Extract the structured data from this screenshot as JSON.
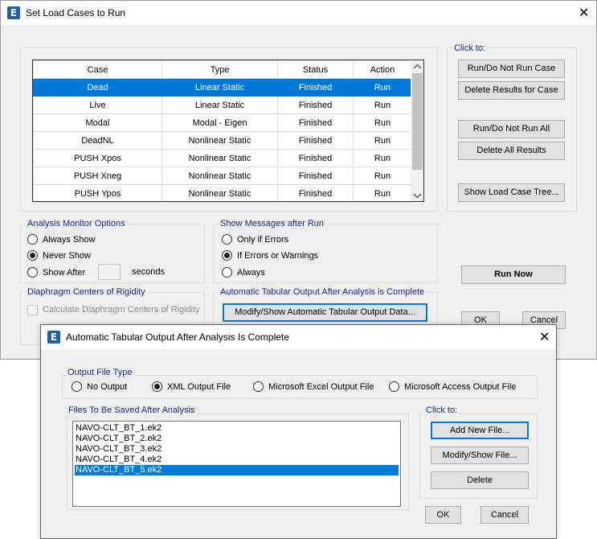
{
  "main": {
    "title": "Set Load Cases to Run",
    "table": {
      "headers": [
        "Case",
        "Type",
        "Status",
        "Action"
      ],
      "rows": [
        [
          "Dead",
          "Linear Static",
          "Finished",
          "Run"
        ],
        [
          "Live",
          "Linear Static",
          "Finished",
          "Run"
        ],
        [
          "Modal",
          "Modal - Eigen",
          "Finished",
          "Run"
        ],
        [
          "DeadNL",
          "Nonlinear Static",
          "Finished",
          "Run"
        ],
        [
          "PUSH Xpos",
          "Nonlinear Static",
          "Finished",
          "Run"
        ],
        [
          "PUSH Xneg",
          "Nonlinear Static",
          "Finished",
          "Run"
        ],
        [
          "PUSH Ypos",
          "Nonlinear Static",
          "Finished",
          "Run"
        ]
      ],
      "selected_row": 0
    },
    "click_to": {
      "label": "Click to:",
      "run_do_not_run_case": "Run/Do Not Run Case",
      "delete_results_for_case": "Delete Results for Case",
      "run_do_not_run_all": "Run/Do Not Run All",
      "delete_all_results": "Delete All Results",
      "show_load_case_tree": "Show Load Case Tree..."
    },
    "monitor": {
      "label": "Analysis Monitor Options",
      "always_show": "Always Show",
      "never_show": "Never Show",
      "show_after": "Show After",
      "seconds": "seconds",
      "selected": "never_show"
    },
    "messages": {
      "label": "Show Messages after Run",
      "only_if_errors": "Only if Errors",
      "if_errors_or_warnings": "If Errors or Warnings",
      "always": "Always",
      "selected": "if_errors_or_warnings"
    },
    "diaphragm": {
      "label": "Diaphragm Centers of Rigidity",
      "calculate": "Calculate Diaphragm Centers of Rigidity"
    },
    "auto_output": {
      "label": "Automatic Tabular Output After Analysis is Complete",
      "modify_button": "Modify/Show Automatic Tabular Output Data..."
    },
    "run_now": "Run Now",
    "ok": "OK",
    "cancel": "Cancel"
  },
  "dialog": {
    "title": "Automatic Tabular Output After Analysis Is Complete",
    "file_type": {
      "label": "Output File Type",
      "no_output": "No Output",
      "xml": "XML Output File",
      "excel": "Microsoft Excel Output File",
      "access": "Microsoft Access Output File",
      "selected": "xml"
    },
    "files": {
      "label": "Files To Be Saved After Analysis",
      "items": [
        "NAVO-CLT_BT_1.ek2",
        "NAVO-CLT_BT_2.ek2",
        "NAVO-CLT_BT_3.ek2",
        "NAVO-CLT_BT_4.ek2",
        "NAVO-CLT_BT_5.ek2"
      ],
      "selected_index": 4
    },
    "click_to": {
      "label": "Click to:",
      "add_new_file": "Add New File...",
      "modify_show_file": "Modify/Show File...",
      "delete": "Delete"
    },
    "ok": "OK",
    "cancel": "Cancel"
  },
  "icons": {
    "app": "etabs-logo-icon",
    "close": "close-icon",
    "scroll_up": "chevron-up-icon",
    "scroll_down": "chevron-down-icon"
  },
  "colors": {
    "selection": "#0078d7",
    "group_label": "#1a2a8a",
    "app_icon": "#1f5fa8"
  }
}
